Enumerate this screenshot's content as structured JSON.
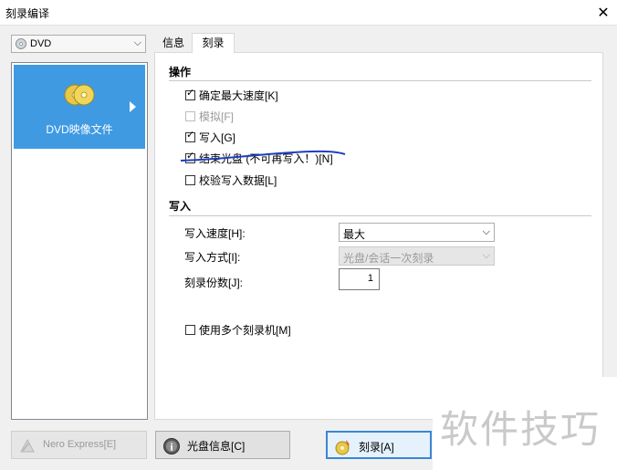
{
  "window": {
    "title": "刻录编译",
    "close_symbol": "✕"
  },
  "device_select": {
    "value": "DVD"
  },
  "left_list": {
    "items": [
      {
        "label": "DVD映像文件"
      }
    ]
  },
  "tabs": [
    {
      "label": "信息"
    },
    {
      "label": "刻录"
    }
  ],
  "operations": {
    "title": "操作",
    "checkboxes": [
      {
        "label": "确定最大速度[K]",
        "checked": true,
        "enabled": true
      },
      {
        "label": "模拟[F]",
        "checked": false,
        "enabled": false
      },
      {
        "label": "写入[G]",
        "checked": true,
        "enabled": true
      },
      {
        "label": "结束光盘 (不可再写入！)[N]",
        "checked": true,
        "enabled": true
      },
      {
        "label": "校验写入数据[L]",
        "checked": false,
        "enabled": true
      }
    ]
  },
  "write": {
    "title": "写入",
    "speed_label": "写入速度[H]:",
    "speed_value": "最大",
    "method_label": "写入方式[I]:",
    "method_value": "光盘/会话一次刻录",
    "copies_label": "刻录份数[J]:",
    "copies_value": "1",
    "multi_recorder_label": "使用多个刻录机[M]"
  },
  "buttons": {
    "nero_express": "Nero Express[E]",
    "disc_info": "光盘信息[C]",
    "burn": "刻录[A]"
  },
  "watermark": {
    "text": "软件技巧"
  },
  "colors": {
    "selection": "#3f9ae2",
    "annotation": "#1f3fbf",
    "focus_border": "#3a86d4"
  }
}
